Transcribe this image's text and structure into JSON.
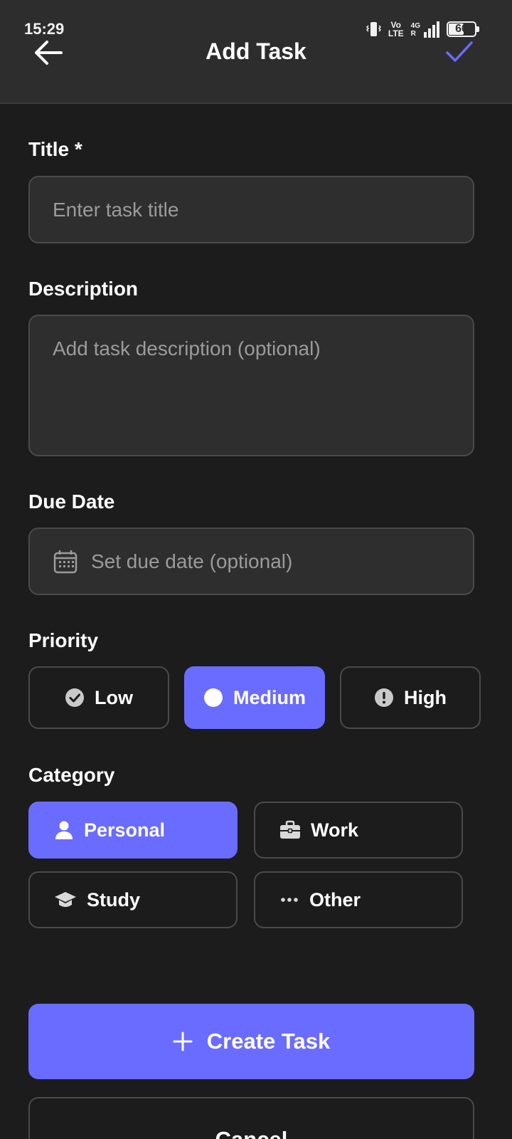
{
  "status_bar": {
    "time": "15:29",
    "volte_top": "Vo",
    "volte_bottom": "LTE",
    "net_top": "4G",
    "net_bottom": "R",
    "battery": "60",
    "battery_level": 0.6
  },
  "header": {
    "title": "Add Task",
    "back_icon": "arrow-left-icon",
    "confirm_icon": "check-icon"
  },
  "form": {
    "title_label": "Title *",
    "title_placeholder": "Enter task title",
    "description_label": "Description",
    "description_placeholder": "Add task description (optional)",
    "due_date_label": "Due Date",
    "due_date_placeholder": "Set due date (optional)",
    "priority_label": "Priority",
    "priority_options": [
      {
        "label": "Low",
        "icon": "check-circle-icon",
        "selected": false
      },
      {
        "label": "Medium",
        "icon": "circle-icon",
        "selected": true
      },
      {
        "label": "High",
        "icon": "exclamation-circle-icon",
        "selected": false
      }
    ],
    "category_label": "Category",
    "category_options": [
      {
        "label": "Personal",
        "icon": "person-icon",
        "selected": true
      },
      {
        "label": "Work",
        "icon": "briefcase-icon",
        "selected": false
      },
      {
        "label": "Study",
        "icon": "graduation-cap-icon",
        "selected": false
      },
      {
        "label": "Other",
        "icon": "more-horizontal-icon",
        "selected": false
      }
    ]
  },
  "actions": {
    "create_label": "Create Task",
    "cancel_label": "Cancel"
  },
  "colors": {
    "accent": "#6a6cff",
    "background": "#1c1c1c",
    "surface": "#2e2e2e",
    "appbar": "#2d2d2d"
  }
}
